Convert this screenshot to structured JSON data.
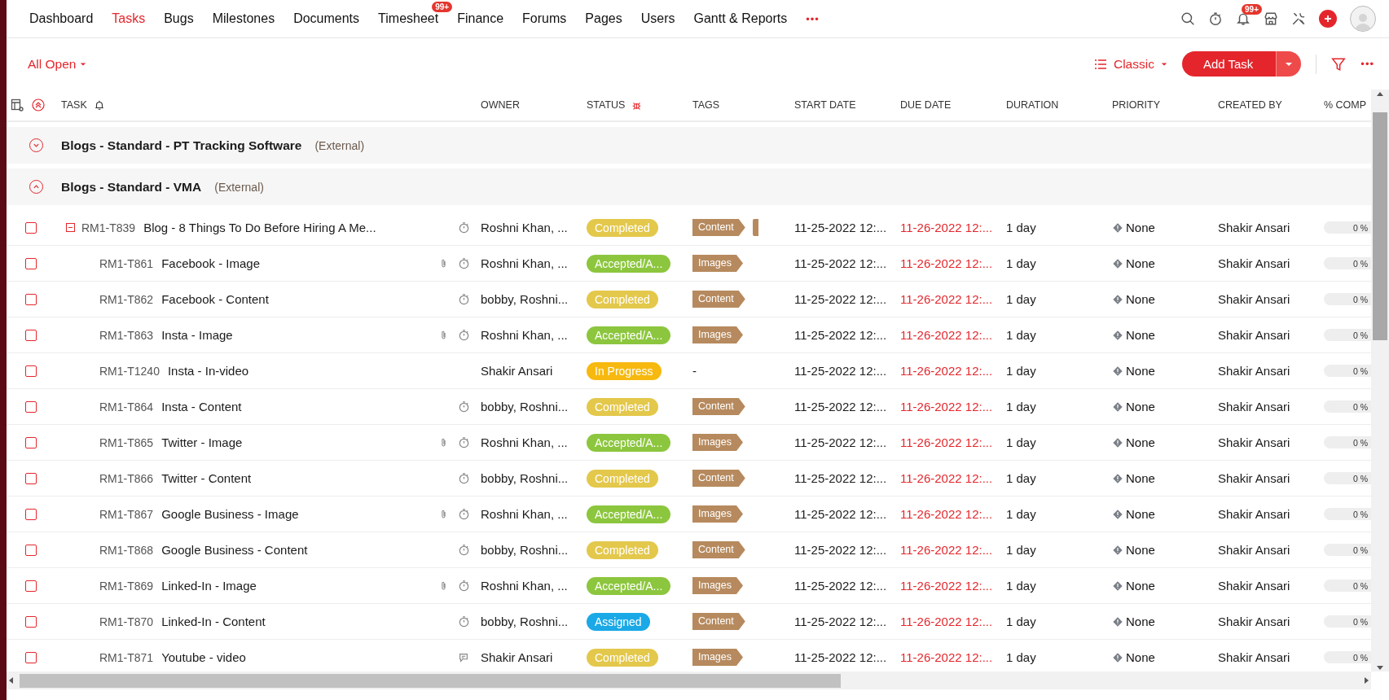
{
  "nav": {
    "items": [
      {
        "label": "Dashboard",
        "selected": false
      },
      {
        "label": "Tasks",
        "selected": true
      },
      {
        "label": "Bugs",
        "selected": false
      },
      {
        "label": "Milestones",
        "selected": false
      },
      {
        "label": "Documents",
        "selected": false
      },
      {
        "label": "Timesheet",
        "selected": false,
        "badge": "99+"
      },
      {
        "label": "Finance",
        "selected": false
      },
      {
        "label": "Forums",
        "selected": false
      },
      {
        "label": "Pages",
        "selected": false
      },
      {
        "label": "Users",
        "selected": false
      },
      {
        "label": "Gantt & Reports",
        "selected": false
      }
    ],
    "more": "•••",
    "notification_badge": "99+"
  },
  "toolbar": {
    "filter_label": "All Open",
    "view_label": "Classic",
    "add_button": "Add Task",
    "more": "•••"
  },
  "table": {
    "columns": [
      "TASK",
      "OWNER",
      "STATUS",
      "TAGS",
      "START DATE",
      "DUE DATE",
      "DURATION",
      "PRIORITY",
      "CREATED BY",
      "% COMP"
    ],
    "groups": [
      {
        "name": "Blogs - Standard - PT Tracking Software",
        "visibility": "(External)",
        "expanded": false
      },
      {
        "name": "Blogs - Standard - VMA",
        "visibility": "(External)",
        "expanded": true,
        "tasks": [
          {
            "id": "RM1-T839",
            "title": "Blog - 8 Things To Do Before Hiring A Me...",
            "checked": false,
            "expanded": true,
            "attachment": false,
            "timer": true,
            "comment": false,
            "owner": "Roshni Khan, ...",
            "status": {
              "label": "Completed",
              "color": "#e3c84b"
            },
            "tags": [
              {
                "label": "Content"
              }
            ],
            "tag_overflow": true,
            "start_date": "11-25-2022 12:...",
            "due_date": "11-26-2022 12:...",
            "duration": "1 day",
            "priority": "None",
            "created_by": "Shakir Ansari",
            "progress": {
              "label": "0 %",
              "level": 0
            },
            "children": [
              {
                "id": "RM1-T861",
                "title": "Facebook - Image",
                "checked": false,
                "attachment": true,
                "timer": true,
                "comment": false,
                "owner": "Roshni Khan, ...",
                "status": {
                  "label": "Accepted/A...",
                  "color": "#8cc63e"
                },
                "tags": [
                  {
                    "label": "Images"
                  }
                ],
                "tag_overflow": false,
                "start_date": "11-25-2022 12:...",
                "due_date": "11-26-2022 12:...",
                "duration": "1 day",
                "priority": "None",
                "created_by": "Shakir Ansari",
                "progress": {
                  "label": "0 %",
                  "level": 0
                }
              },
              {
                "id": "RM1-T862",
                "title": "Facebook - Content",
                "checked": false,
                "attachment": false,
                "timer": true,
                "comment": false,
                "owner": "bobby, Roshni...",
                "status": {
                  "label": "Completed",
                  "color": "#e3c84b"
                },
                "tags": [
                  {
                    "label": "Content"
                  }
                ],
                "tag_overflow": false,
                "start_date": "11-25-2022 12:...",
                "due_date": "11-26-2022 12:...",
                "duration": "1 day",
                "priority": "None",
                "created_by": "Shakir Ansari",
                "progress": {
                  "label": "0 %",
                  "level": 0
                }
              },
              {
                "id": "RM1-T863",
                "title": "Insta - Image",
                "checked": false,
                "attachment": true,
                "timer": true,
                "comment": false,
                "owner": "Roshni Khan, ...",
                "status": {
                  "label": "Accepted/A...",
                  "color": "#8cc63e"
                },
                "tags": [
                  {
                    "label": "Images"
                  }
                ],
                "tag_overflow": false,
                "start_date": "11-25-2022 12:...",
                "due_date": "11-26-2022 12:...",
                "duration": "1 day",
                "priority": "None",
                "created_by": "Shakir Ansari",
                "progress": {
                  "label": "0 %",
                  "level": 0
                }
              },
              {
                "id": "RM1-T1240",
                "title": "Insta - In-video",
                "checked": false,
                "attachment": false,
                "timer": false,
                "comment": false,
                "owner": "Shakir Ansari",
                "status": {
                  "label": "In Progress",
                  "color": "#f7b90f"
                },
                "tag_text": "-",
                "tag_overflow": false,
                "start_date": "11-25-2022 12:...",
                "due_date": "11-26-2022 12:...",
                "duration": "1 day",
                "priority": "None",
                "created_by": "Shakir Ansari",
                "progress": {
                  "label": "0 %",
                  "level": 0
                }
              },
              {
                "id": "RM1-T864",
                "title": "Insta - Content",
                "checked": false,
                "attachment": false,
                "timer": true,
                "comment": false,
                "owner": "bobby, Roshni...",
                "status": {
                  "label": "Completed",
                  "color": "#e3c84b"
                },
                "tags": [
                  {
                    "label": "Content"
                  }
                ],
                "tag_overflow": false,
                "start_date": "11-25-2022 12:...",
                "due_date": "11-26-2022 12:...",
                "duration": "1 day",
                "priority": "None",
                "created_by": "Shakir Ansari",
                "progress": {
                  "label": "0 %",
                  "level": 0
                }
              },
              {
                "id": "RM1-T865",
                "title": "Twitter - Image",
                "checked": false,
                "attachment": true,
                "timer": true,
                "comment": false,
                "owner": "Roshni Khan, ...",
                "status": {
                  "label": "Accepted/A...",
                  "color": "#8cc63e"
                },
                "tags": [
                  {
                    "label": "Images"
                  }
                ],
                "tag_overflow": false,
                "start_date": "11-25-2022 12:...",
                "due_date": "11-26-2022 12:...",
                "duration": "1 day",
                "priority": "None",
                "created_by": "Shakir Ansari",
                "progress": {
                  "label": "0 %",
                  "level": 0
                }
              },
              {
                "id": "RM1-T866",
                "title": "Twitter - Content",
                "checked": false,
                "attachment": false,
                "timer": true,
                "comment": false,
                "owner": "bobby, Roshni...",
                "status": {
                  "label": "Completed",
                  "color": "#e3c84b"
                },
                "tags": [
                  {
                    "label": "Content"
                  }
                ],
                "tag_overflow": false,
                "start_date": "11-25-2022 12:...",
                "due_date": "11-26-2022 12:...",
                "duration": "1 day",
                "priority": "None",
                "created_by": "Shakir Ansari",
                "progress": {
                  "label": "0 %",
                  "level": 0
                }
              },
              {
                "id": "RM1-T867",
                "title": "Google Business - Image",
                "checked": false,
                "attachment": true,
                "timer": true,
                "comment": false,
                "owner": "Roshni Khan, ...",
                "status": {
                  "label": "Accepted/A...",
                  "color": "#8cc63e"
                },
                "tags": [
                  {
                    "label": "Images"
                  }
                ],
                "tag_overflow": false,
                "start_date": "11-25-2022 12:...",
                "due_date": "11-26-2022 12:...",
                "duration": "1 day",
                "priority": "None",
                "created_by": "Shakir Ansari",
                "progress": {
                  "label": "0 %",
                  "level": 0
                }
              },
              {
                "id": "RM1-T868",
                "title": "Google Business - Content",
                "checked": false,
                "attachment": false,
                "timer": true,
                "comment": false,
                "owner": "bobby, Roshni...",
                "status": {
                  "label": "Completed",
                  "color": "#e3c84b"
                },
                "tags": [
                  {
                    "label": "Content"
                  }
                ],
                "tag_overflow": false,
                "start_date": "11-25-2022 12:...",
                "due_date": "11-26-2022 12:...",
                "duration": "1 day",
                "priority": "None",
                "created_by": "Shakir Ansari",
                "progress": {
                  "label": "0 %",
                  "level": 0
                }
              },
              {
                "id": "RM1-T869",
                "title": "Linked-In - Image",
                "checked": false,
                "attachment": true,
                "timer": true,
                "comment": false,
                "owner": "Roshni Khan, ...",
                "status": {
                  "label": "Accepted/A...",
                  "color": "#8cc63e"
                },
                "tags": [
                  {
                    "label": "Images"
                  }
                ],
                "tag_overflow": false,
                "start_date": "11-25-2022 12:...",
                "due_date": "11-26-2022 12:...",
                "duration": "1 day",
                "priority": "None",
                "created_by": "Shakir Ansari",
                "progress": {
                  "label": "0 %",
                  "level": 0
                }
              },
              {
                "id": "RM1-T870",
                "title": "Linked-In - Content",
                "checked": false,
                "attachment": false,
                "timer": true,
                "comment": false,
                "owner": "bobby, Roshni...",
                "status": {
                  "label": "Assigned",
                  "color": "#1aa9e6"
                },
                "tags": [
                  {
                    "label": "Content"
                  }
                ],
                "tag_overflow": false,
                "start_date": "11-25-2022 12:...",
                "due_date": "11-26-2022 12:...",
                "duration": "1 day",
                "priority": "None",
                "created_by": "Shakir Ansari",
                "progress": {
                  "label": "0 %",
                  "level": 0
                }
              },
              {
                "id": "RM1-T871",
                "title": "Youtube - video",
                "checked": false,
                "attachment": false,
                "timer": false,
                "comment": true,
                "owner": "Shakir Ansari",
                "status": {
                  "label": "Completed",
                  "color": "#e3c84b"
                },
                "tags": [
                  {
                    "label": "Images"
                  }
                ],
                "tag_overflow": false,
                "start_date": "11-25-2022 12:...",
                "due_date": "11-26-2022 12:...",
                "duration": "1 day",
                "priority": "None",
                "created_by": "Shakir Ansari",
                "progress": {
                  "label": "0 %",
                  "level": 0
                }
              }
            ]
          }
        ]
      }
    ]
  }
}
